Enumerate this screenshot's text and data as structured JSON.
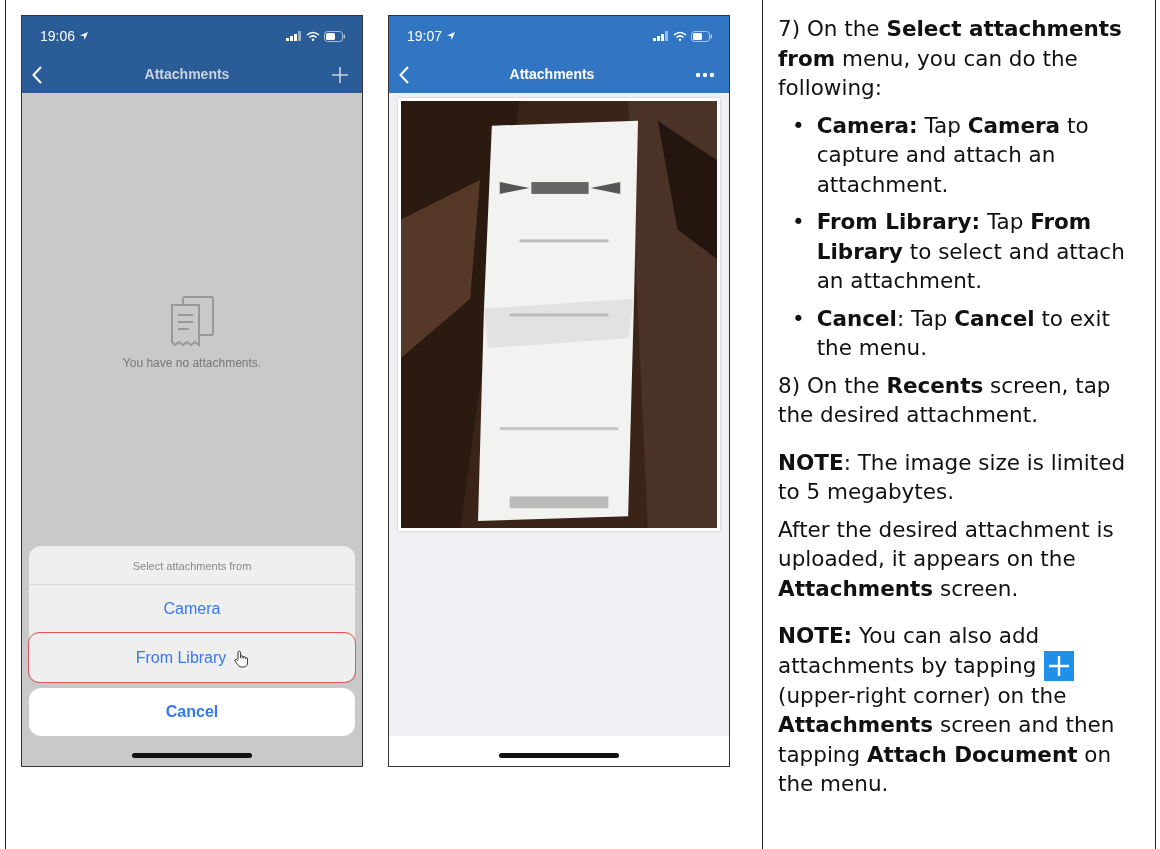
{
  "phones": [
    {
      "time": "19:06",
      "title": "Attachments",
      "dimmed": true,
      "right_button": {
        "kind": "plus"
      },
      "content": {
        "kind": "empty",
        "message": "You have no attachments."
      },
      "sheet": {
        "header": "Select attachments from",
        "options": [
          {
            "label": "Camera",
            "highlighted": false
          },
          {
            "label": "From Library",
            "highlighted": true
          }
        ],
        "cancel": "Cancel"
      }
    },
    {
      "time": "19:07",
      "title": "Attachments",
      "dimmed": false,
      "right_button": {
        "kind": "more"
      }
    }
  ],
  "instructions": [
    {
      "kind": "para",
      "text": "7) On the **Select attachments from** menu, you can do the following:"
    },
    {
      "kind": "bullets",
      "items": [
        {
          "marker": "•",
          "text": "**Camera:** Tap **Camera** to capture and attach an attachment."
        },
        {
          "marker": "•",
          "text": "**From Library:** Tap **From Library** to select and attach an attachment."
        },
        {
          "marker": "•",
          "text": "**Cancel**: Tap **Cancel** to exit the menu."
        }
      ]
    },
    {
      "kind": "para",
      "text": "8) On the **Recents** screen, tap the desired attachment."
    },
    {
      "kind": "note",
      "text": "**NOTE**: The image size is limited to 5 megabytes."
    },
    {
      "kind": "para",
      "text": "After the desired attachment is uploaded, it appears on the **Attachments** screen."
    },
    {
      "kind": "note_icon",
      "first": "**NOTE:** You can also add",
      "before_icon": "attachments by tapping",
      "after": "(upper-right corner) on the **Attachments** screen and then tapping **Attach Document** on the menu."
    }
  ]
}
